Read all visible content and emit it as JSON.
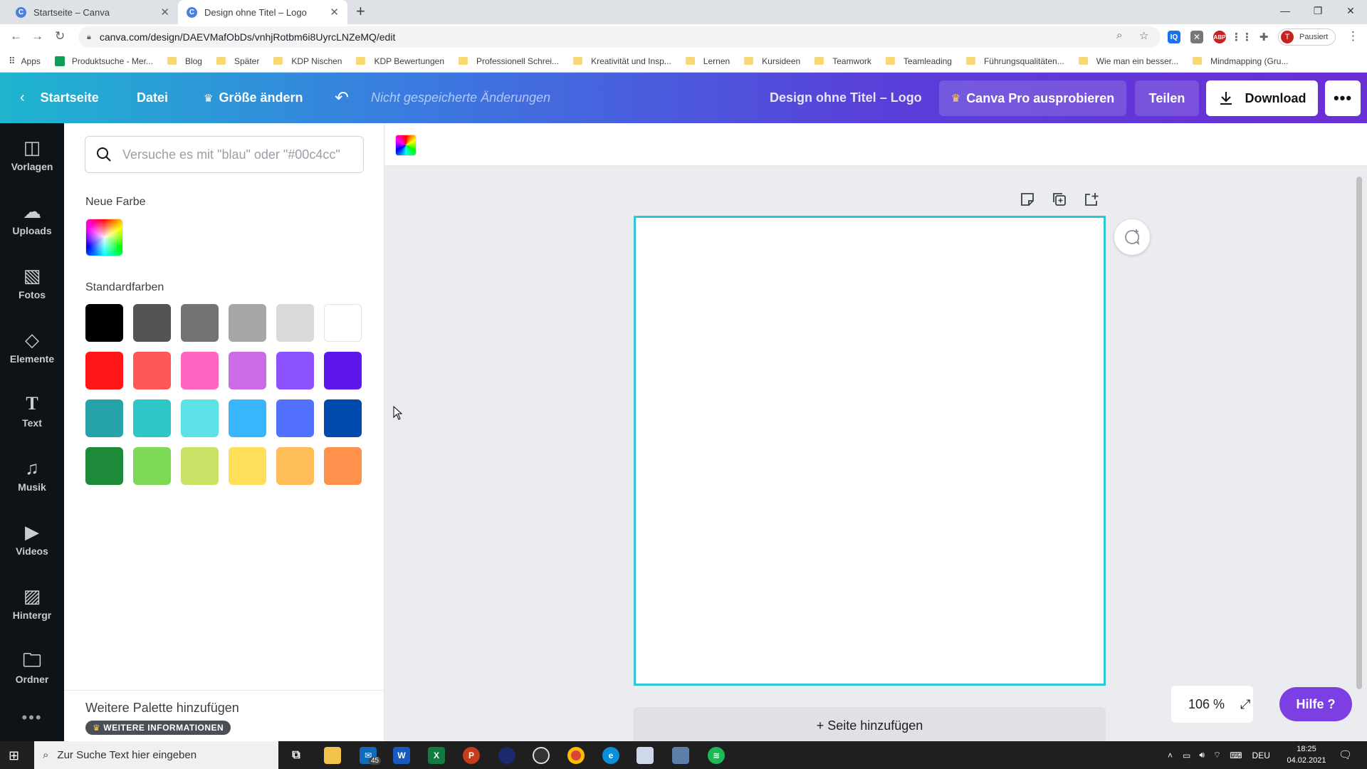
{
  "browser": {
    "tabs": [
      {
        "title": "Startseite – Canva",
        "active": false
      },
      {
        "title": "Design ohne Titel – Logo",
        "active": true
      }
    ],
    "url": "canva.com/design/DAEVMafObDs/vnhjRotbm6i8UyrcLNZeMQ/edit",
    "profile_status": "Pausiert",
    "profile_initial": "T",
    "bookmarks": [
      "Apps",
      "Produktsuche - Mer...",
      "Blog",
      "Später",
      "KDP Nischen",
      "KDP Bewertungen",
      "Professionell Schrei...",
      "Kreativität und Insp...",
      "Lernen",
      "Kursideen",
      "Teamwork",
      "Teamleading",
      "Führungsqualitäten...",
      "Wie man ein besser...",
      "Mindmapping (Gru..."
    ]
  },
  "header": {
    "home": "Startseite",
    "file": "Datei",
    "resize": "Größe ändern",
    "unsaved": "Nicht gespeicherte Änderungen",
    "design_title": "Design ohne Titel – Logo",
    "pro": "Canva Pro ausprobieren",
    "share": "Teilen",
    "download": "Download"
  },
  "sidebar": {
    "items": [
      {
        "label": "Vorlagen",
        "icon": "template-icon"
      },
      {
        "label": "Uploads",
        "icon": "upload-icon"
      },
      {
        "label": "Fotos",
        "icon": "photo-icon"
      },
      {
        "label": "Elemente",
        "icon": "elements-icon"
      },
      {
        "label": "Text",
        "icon": "text-icon"
      },
      {
        "label": "Musik",
        "icon": "music-icon"
      },
      {
        "label": "Videos",
        "icon": "video-icon"
      },
      {
        "label": "Hintergr",
        "icon": "background-icon"
      },
      {
        "label": "Ordner",
        "icon": "folder-icon"
      }
    ]
  },
  "panel": {
    "search_placeholder": "Versuche es mit \"blau\" oder \"#00c4cc\"",
    "new_color_label": "Neue Farbe",
    "default_colors_label": "Standardfarben",
    "colors": [
      "#000000",
      "#545454",
      "#737373",
      "#a6a6a6",
      "#d9d9d9",
      "#ffffff",
      "#ff1616",
      "#ff5757",
      "#ff66c4",
      "#cb6ce6",
      "#8c52ff",
      "#5e17eb",
      "#25a3a8",
      "#2ec6c6",
      "#5ce1e6",
      "#38b6ff",
      "#5271ff",
      "#004aad",
      "#1d8a3a",
      "#7ed957",
      "#c9e265",
      "#ffde59",
      "#ffbd59",
      "#ff914d"
    ],
    "more_palette": "Weitere Palette hinzufügen",
    "more_info": "WEITERE INFORMATIONEN"
  },
  "canvas": {
    "add_page": "+ Seite hinzufügen",
    "zoom": "106 %",
    "help": "Hilfe ?",
    "selection_color": "#2ec7d4"
  },
  "taskbar": {
    "search_placeholder": "Zur Suche Text hier eingeben",
    "mail_badge": "45",
    "language": "DEU",
    "time": "18:25",
    "date": "04.02.2021"
  }
}
